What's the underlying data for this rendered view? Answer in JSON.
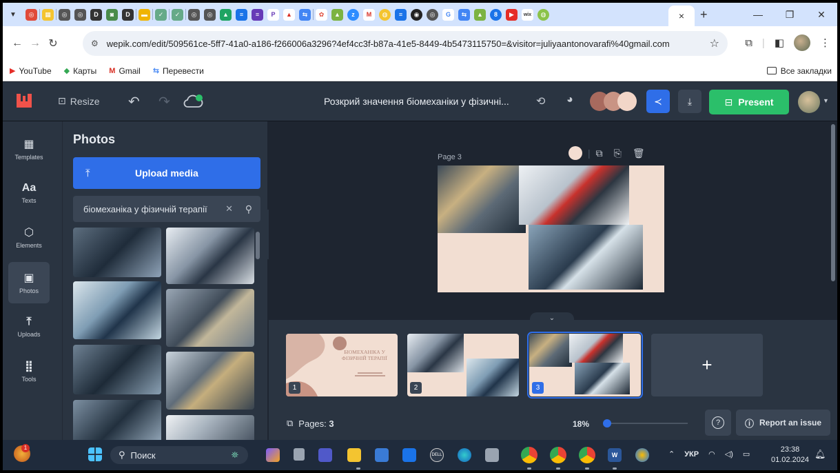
{
  "browser": {
    "active_tab_close": "×",
    "new_tab": "+",
    "url": "wepik.com/edit/509561ce-5ff7-41a0-a186-f266006a3296?4ef4cc3f-b87a-41e5-8449-4b5473115750=&visitor=juliyaantonovarafi%40gmail.com",
    "bookmarks": [
      {
        "label": "YouTube"
      },
      {
        "label": "Карты"
      },
      {
        "label": "Gmail"
      },
      {
        "label": "Перевести"
      }
    ],
    "all_bookmarks": "Все закладки"
  },
  "app": {
    "resize_label": "Resize",
    "document_title": "Розкрий значення біомеханіки у фізичні...",
    "present_label": "Present",
    "rail": [
      {
        "label": "Templates",
        "icon": "grid-icon"
      },
      {
        "label": "Texts",
        "icon": "text-icon"
      },
      {
        "label": "Elements",
        "icon": "shapes-icon"
      },
      {
        "label": "Photos",
        "icon": "image-icon"
      },
      {
        "label": "Uploads",
        "icon": "upload-icon"
      },
      {
        "label": "Tools",
        "icon": "apps-icon"
      }
    ],
    "panel": {
      "title": "Photos",
      "upload_label": "Upload media",
      "search_value": "біомеханіка у фізичній терапії"
    },
    "canvas": {
      "page_label": "Page 3"
    },
    "slide1": {
      "title": "БІОМЕХАНІКА У ФІЗИЧНІЙ ТЕРАПІЇ"
    },
    "pages": [
      {
        "num": "1"
      },
      {
        "num": "2"
      },
      {
        "num": "3"
      }
    ],
    "add_page": "+",
    "pages_count_label": "Pages:",
    "pages_count_value": "3",
    "zoom_label": "18%",
    "zoom_value": 0.18,
    "help": "?",
    "report_label": "Report an issue"
  },
  "taskbar": {
    "search_placeholder": "Поиск",
    "language": "УКР",
    "time": "23:38",
    "date": "01.02.2024"
  },
  "colors": {
    "accent": "#2f6ee8",
    "present": "#2bbf6a",
    "app_bg": "#2a3441",
    "canvas_bg": "#1e2530",
    "slide_bg": "#f2ded2"
  }
}
